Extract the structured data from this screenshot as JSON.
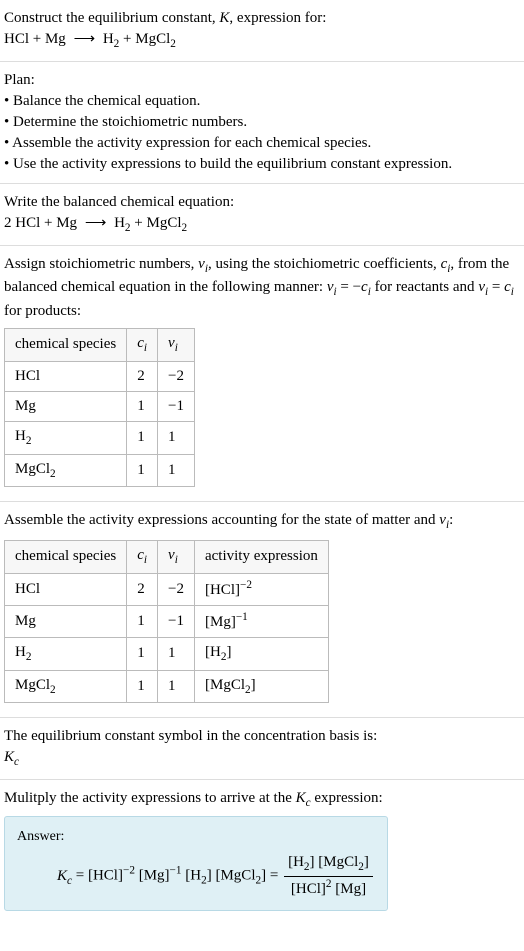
{
  "title_line1": "Construct the equilibrium constant, K, expression for:",
  "title_eq": "HCl + Mg ⟶ H₂ + MgCl₂",
  "plan_heading": "Plan:",
  "plan_items": [
    "• Balance the chemical equation.",
    "• Determine the stoichiometric numbers.",
    "• Assemble the activity expression for each chemical species.",
    "• Use the activity expressions to build the equilibrium constant expression."
  ],
  "balanced_heading": "Write the balanced chemical equation:",
  "balanced_eq": "2 HCl + Mg ⟶ H₂ + MgCl₂",
  "assign_text": "Assign stoichiometric numbers, νᵢ, using the stoichiometric coefficients, cᵢ, from the balanced chemical equation in the following manner: νᵢ = −cᵢ for reactants and νᵢ = cᵢ for products:",
  "table1_headers": [
    "chemical species",
    "cᵢ",
    "νᵢ"
  ],
  "table1_rows": [
    [
      "HCl",
      "2",
      "−2"
    ],
    [
      "Mg",
      "1",
      "−1"
    ],
    [
      "H₂",
      "1",
      "1"
    ],
    [
      "MgCl₂",
      "1",
      "1"
    ]
  ],
  "assemble_text": "Assemble the activity expressions accounting for the state of matter and νᵢ:",
  "table2_headers": [
    "chemical species",
    "cᵢ",
    "νᵢ",
    "activity expression"
  ],
  "table2_rows": [
    [
      "HCl",
      "2",
      "−2",
      "[HCl]⁻²"
    ],
    [
      "Mg",
      "1",
      "−1",
      "[Mg]⁻¹"
    ],
    [
      "H₂",
      "1",
      "1",
      "[H₂]"
    ],
    [
      "MgCl₂",
      "1",
      "1",
      "[MgCl₂]"
    ]
  ],
  "kc_symbol_text": "The equilibrium constant symbol in the concentration basis is:",
  "kc_symbol": "K_c",
  "multiply_text": "Mulitply the activity expressions to arrive at the K_c expression:",
  "answer_label": "Answer:",
  "answer_lhs": "K_c = [HCl]⁻² [Mg]⁻¹ [H₂] [MgCl₂] =",
  "answer_frac_num": "[H₂] [MgCl₂]",
  "answer_frac_den": "[HCl]² [Mg]",
  "chart_data": {
    "type": "table",
    "tables": [
      {
        "headers": [
          "chemical species",
          "c_i",
          "nu_i"
        ],
        "rows": [
          [
            "HCl",
            2,
            -2
          ],
          [
            "Mg",
            1,
            -1
          ],
          [
            "H2",
            1,
            1
          ],
          [
            "MgCl2",
            1,
            1
          ]
        ]
      },
      {
        "headers": [
          "chemical species",
          "c_i",
          "nu_i",
          "activity expression"
        ],
        "rows": [
          [
            "HCl",
            2,
            -2,
            "[HCl]^-2"
          ],
          [
            "Mg",
            1,
            -1,
            "[Mg]^-1"
          ],
          [
            "H2",
            1,
            1,
            "[H2]"
          ],
          [
            "MgCl2",
            1,
            1,
            "[MgCl2]"
          ]
        ]
      }
    ]
  }
}
